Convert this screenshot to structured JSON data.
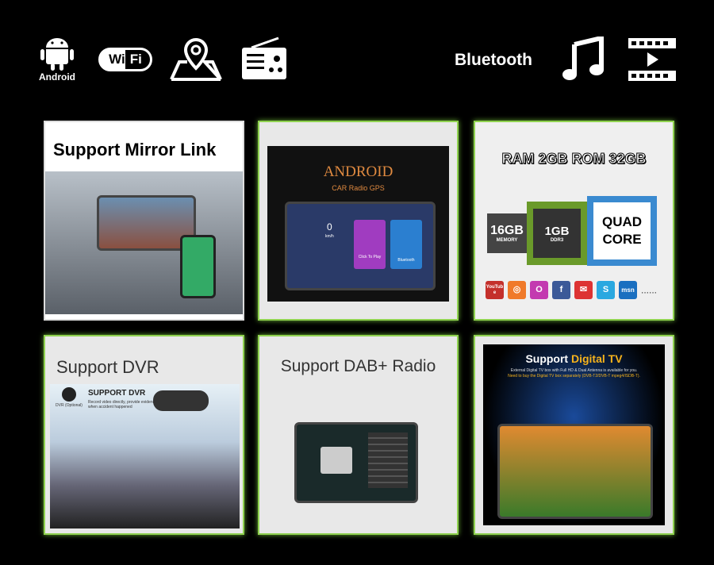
{
  "top_icons": {
    "android": "Android",
    "wifi": "Wi Fi",
    "bluetooth": "Bluetooth"
  },
  "cards": {
    "mirror": {
      "title": "Support Mirror Link"
    },
    "android": {
      "title": "ANDROID",
      "subtitle": "CAR Radio GPS",
      "speed": "0",
      "speed_unit": "km/h",
      "click_to_play": "Click To Play",
      "bluetooth": "Bluetooth"
    },
    "specs": {
      "title": "RAM 2GB ROM 32GB",
      "memory": "16GB",
      "memory_label": "MEMORY",
      "ram": "1GB",
      "ram_label": "DDR3",
      "core": "QUAD CORE",
      "apps": [
        "YouTube",
        "Podcast",
        "Opera",
        "Facebook",
        "Mail",
        "Skype",
        "msn"
      ],
      "more": "......"
    },
    "dvr": {
      "title": "Support  DVR",
      "heading": "SUPPORT DVR",
      "desc": "Record video directly, provide evidence when accident happened",
      "icon_label": "DVR (Optional)"
    },
    "dab": {
      "title": "Support DAB+ Radio"
    },
    "tv": {
      "title_a": "Support ",
      "title_b": "Digital TV",
      "line1": "External Digital TV box with Full HD & Dual Antenna is available for you.",
      "line2": "Need to buy the Digital TV box separately (DVB-T2/DVB-T mpeg4/ISDB-T)."
    }
  },
  "colors": {
    "accent_green": "#8fd14f",
    "tv_yellow": "#f5b21b"
  }
}
